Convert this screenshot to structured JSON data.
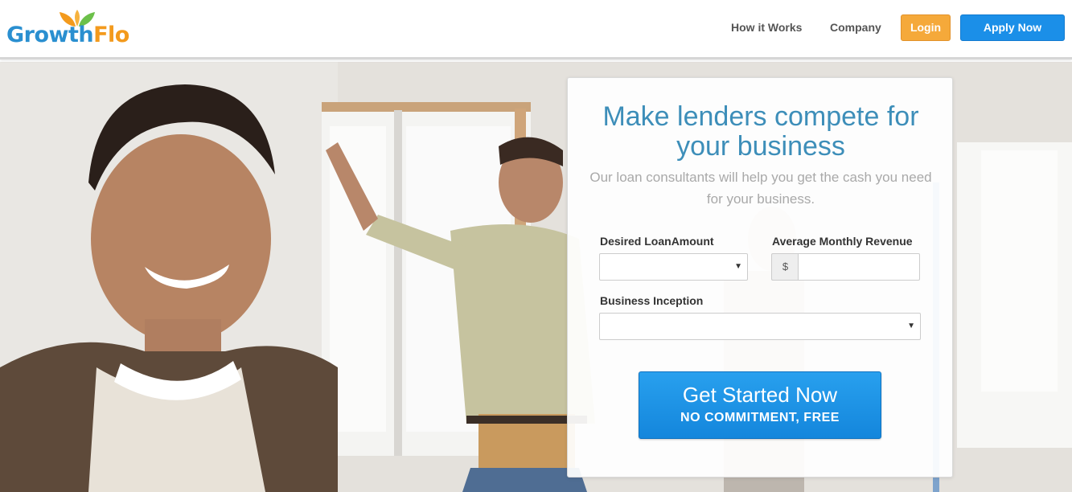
{
  "header": {
    "logo": {
      "part1": "Growth",
      "part2": "Flo"
    },
    "nav": [
      {
        "label": "How it Works"
      },
      {
        "label": "Company"
      }
    ],
    "login_label": "Login",
    "apply_label": "Apply Now"
  },
  "form": {
    "title": "Make lenders compete for your business",
    "subtitle": "Our loan consultants will help you get the cash you need for your business.",
    "loan_amount": {
      "label": "Desired LoanAmount",
      "value": ""
    },
    "revenue": {
      "label": "Average Monthly Revenue",
      "prefix": "$",
      "value": ""
    },
    "inception": {
      "label": "Business Inception",
      "value": ""
    },
    "cta": {
      "main": "Get Started Now",
      "sub": "NO COMMITMENT, FREE"
    }
  },
  "colors": {
    "brand_blue": "#2a8fd0",
    "brand_orange": "#f39a1d",
    "login": "#f5a93a",
    "apply": "#1b8fe8",
    "title": "#3d8eb9"
  },
  "icons": [
    "leaf-icon",
    "dropdown-caret-icon"
  ]
}
